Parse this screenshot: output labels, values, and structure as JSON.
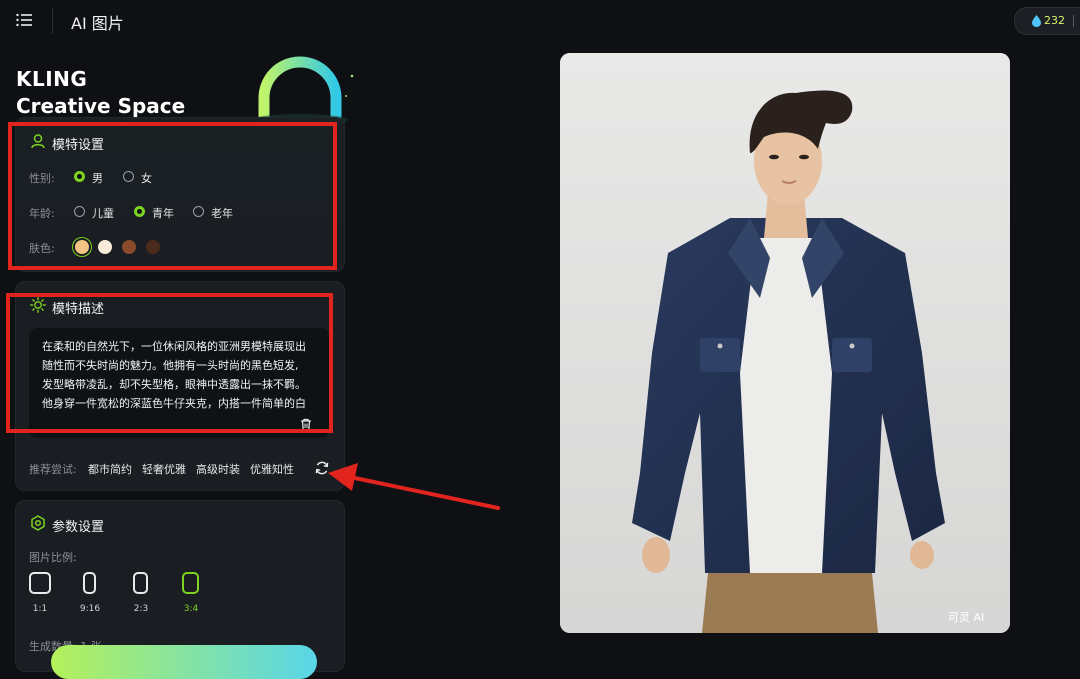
{
  "header": {
    "app_title": "AI 图片",
    "credits": "232"
  },
  "brand": {
    "line1": "KLING",
    "line2": "Creative Space"
  },
  "model_settings": {
    "title": "模特设置",
    "gender_label": "性别:",
    "gender_options": [
      "男",
      "女"
    ],
    "gender_selected": "男",
    "age_label": "年龄:",
    "age_options": [
      "儿童",
      "青年",
      "老年"
    ],
    "age_selected": "青年",
    "skin_label": "肤色:",
    "skin_colors": [
      "#f2c384",
      "#f7ecd9",
      "#8a4b2c",
      "#4a2a1c"
    ],
    "skin_selected_index": 0
  },
  "model_description": {
    "title": "模特描述",
    "lines": [
      "在柔和的自然光下，一位休闲风格的亚洲男模特展现出",
      "随性而不失时尚的魅力。他拥有一头时尚的黑色短发,",
      "发型略带凌乱，却不失型格，眼神中透露出一抹不羁。",
      "他身穿一件宽松的深蓝色牛仔夹克，内搭一件简单的白"
    ],
    "suggest_label": "推荐尝试:",
    "suggestions": [
      "都市简约",
      "轻奢优雅",
      "高级时装",
      "优雅知性"
    ]
  },
  "params": {
    "title": "参数设置",
    "ratio_label": "图片比例:",
    "ratios": [
      "1:1",
      "9:16",
      "2:3",
      "3:4"
    ],
    "ratio_selected": "3:4",
    "count_label": "生成数量: 1 张"
  },
  "preview": {
    "watermark": "可灵 AI"
  },
  "colors": {
    "accent": "#7ed321",
    "annotation_red": "#e2241f",
    "background": "#0e1013",
    "panel": "#1a1e23"
  }
}
